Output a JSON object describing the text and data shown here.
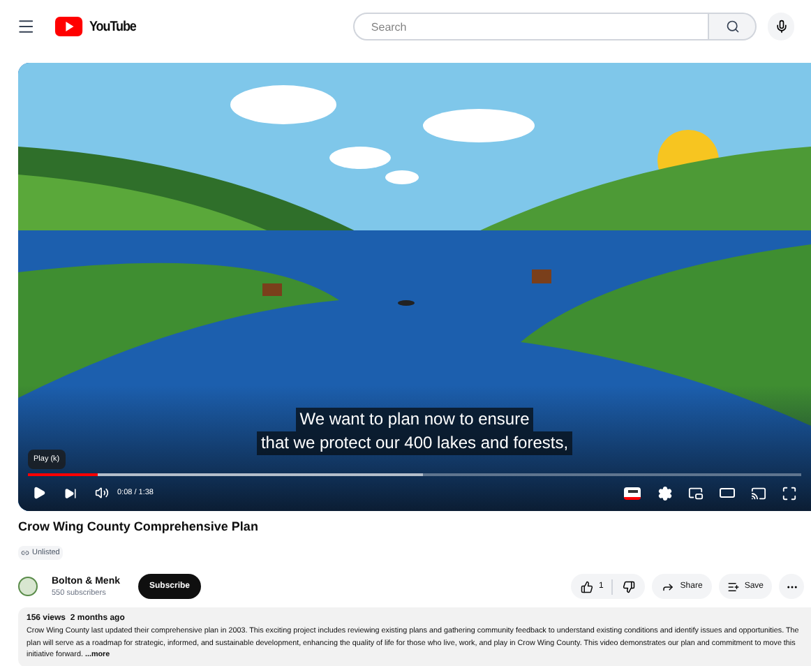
{
  "header": {
    "logo": "YouTube",
    "search": {
      "placeholder": "Search"
    }
  },
  "player": {
    "captions": [
      "We want to plan now to ensure",
      "that we protect our 400 lakes and forests,"
    ],
    "tooltip": "Play (k)",
    "progress": {
      "level": 0.09
    },
    "time": "0:08 / 1:38",
    "captions_on": true
  },
  "video": {
    "title": "Crow Wing County Comprehensive Plan",
    "visibility": "Unlisted",
    "channel": {
      "name": "Bolton & Menk",
      "subscribers": "550 subscribers"
    },
    "subscribe": "Subscribe",
    "likes": "1",
    "share": "Share",
    "save": "Save"
  },
  "description": {
    "stats": "156 views  2 months ago",
    "text": "Crow Wing County last updated their comprehensive plan in 2003. This exciting project includes reviewing existing plans and gathering community feedback to understand existing conditions and identify issues and opportunities. The plan will serve as a roadmap for strategic, informed, and sustainable development, enhancing the quality of life for those who live, work, and play in Crow Wing County. This video demonstrates our plan and commitment to move this initiative forward.",
    "more": "...more"
  }
}
